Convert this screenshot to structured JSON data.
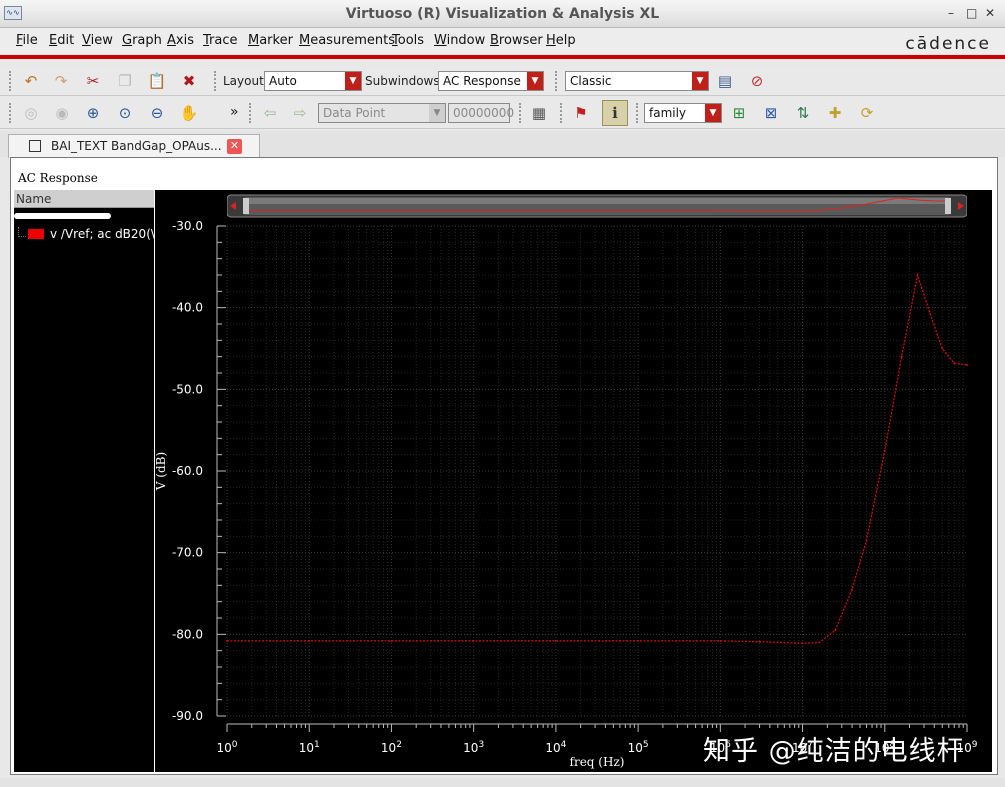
{
  "window": {
    "title": "Virtuoso (R) Visualization & Analysis XL",
    "controls": [
      "–",
      "□",
      "✕"
    ]
  },
  "menu": {
    "items": [
      {
        "accel": "F",
        "rest": "ile"
      },
      {
        "accel": "E",
        "rest": "dit"
      },
      {
        "accel": "V",
        "rest": "iew"
      },
      {
        "accel": "G",
        "rest": "raph"
      },
      {
        "accel": "A",
        "rest": "xis"
      },
      {
        "accel": "T",
        "rest": "race"
      },
      {
        "accel": "M",
        "rest": "arker"
      },
      {
        "accel": "M",
        "rest": "easurements"
      },
      {
        "accel": "T",
        "rest": "ools"
      },
      {
        "accel": "W",
        "rest": "indow"
      },
      {
        "accel": "B",
        "rest": "rowser"
      },
      {
        "accel": "H",
        "rest": "elp"
      }
    ],
    "brand": "cādence"
  },
  "toolbar1": {
    "layout_label": "Layout:",
    "layout_value": "Auto",
    "subwindows_label": "Subwindows:",
    "subwindows_value": "AC Response",
    "style_value": "Classic",
    "icons": [
      "undo-icon",
      "redo-icon",
      "cut-icon",
      "copy-icon",
      "paste-icon",
      "delete-icon",
      "window-settings-icon",
      "window-delete-icon"
    ]
  },
  "toolbar2": {
    "more": "»",
    "datapoint_value": "Data Point",
    "datapoint_number": "00000000",
    "family_value": "family"
  },
  "tab": {
    "label": "BAI_TEXT BandGap_OPAus...",
    "close": "✕"
  },
  "subwindow": {
    "title": "AC Response"
  },
  "trace_panel": {
    "header": "Name",
    "traces": [
      {
        "label": "v /Vref; ac dB20(\\",
        "color": "#ee0000"
      }
    ]
  },
  "watermark": "知乎 @纯洁的电线杆",
  "chart_data": {
    "type": "line",
    "title": "",
    "xlabel": "freq (Hz)",
    "ylabel": "V (dB)",
    "xscale": "log",
    "xlim": [
      1,
      1000000000.0
    ],
    "ylim": [
      -90,
      -30
    ],
    "x_tick_labels": [
      "10^0",
      "10^1",
      "10^2",
      "10^3",
      "10^4",
      "10^5",
      "10^6",
      "10^7",
      "10^8",
      "10^9"
    ],
    "y_ticks": [
      -30.0,
      -40.0,
      -50.0,
      -60.0,
      -70.0,
      -80.0,
      -90.0
    ],
    "y_tick_labels": [
      "-30.0",
      "-40.0",
      "-50.0",
      "-60.0",
      "-70.0",
      "-80.0",
      "-90.0"
    ],
    "grid": true,
    "background": "#000000",
    "series": [
      {
        "name": "v /Vref; ac dB20(\\",
        "color": "#dd1111",
        "x": [
          1,
          10,
          100,
          1000,
          10000,
          100000,
          1000000,
          3000000,
          10000000,
          16000000,
          25000000,
          40000000,
          60000000,
          100000000,
          160000000,
          250000000,
          350000000,
          500000000,
          700000000,
          1000000000
        ],
        "y": [
          -80.8,
          -80.8,
          -80.8,
          -80.8,
          -80.8,
          -80.8,
          -80.8,
          -80.9,
          -81.1,
          -81.0,
          -79.5,
          -74.5,
          -68.5,
          -57.5,
          -46.0,
          -36.0,
          -40.5,
          -45.0,
          -46.8,
          -47.0
        ]
      }
    ]
  }
}
